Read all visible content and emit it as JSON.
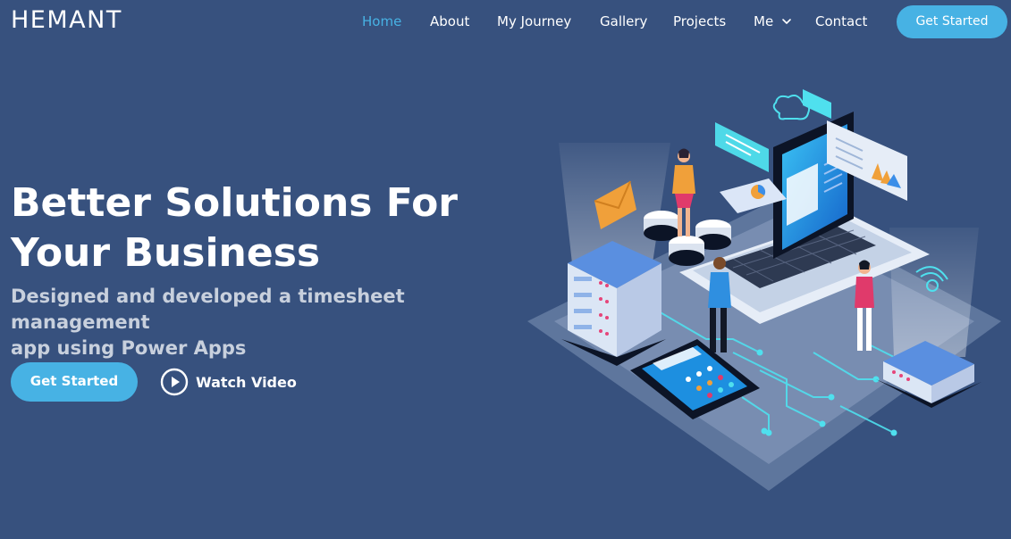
{
  "brand": {
    "logo": "HEMANT"
  },
  "nav": {
    "items": [
      {
        "label": "Home",
        "active": true
      },
      {
        "label": "About"
      },
      {
        "label": "My Journey"
      },
      {
        "label": "Gallery"
      },
      {
        "label": "Projects"
      },
      {
        "label": "Me",
        "icon": "chevron-down-icon"
      },
      {
        "label": "Contact"
      }
    ],
    "cta_label": "Get Started"
  },
  "hero": {
    "title_line1": "Better Solutions For",
    "title_line2": "Your Business",
    "subtitle_line1": "Designed and developed a timesheet management",
    "subtitle_line2": "app using Power Apps",
    "primary_button": "Get Started",
    "video_link": "Watch Video",
    "video_icon": "play-circle-icon"
  },
  "colors": {
    "background": "#37517e",
    "accent": "#47b2e4",
    "text": "#ffffff",
    "subtitle": "#c8d0dd"
  }
}
